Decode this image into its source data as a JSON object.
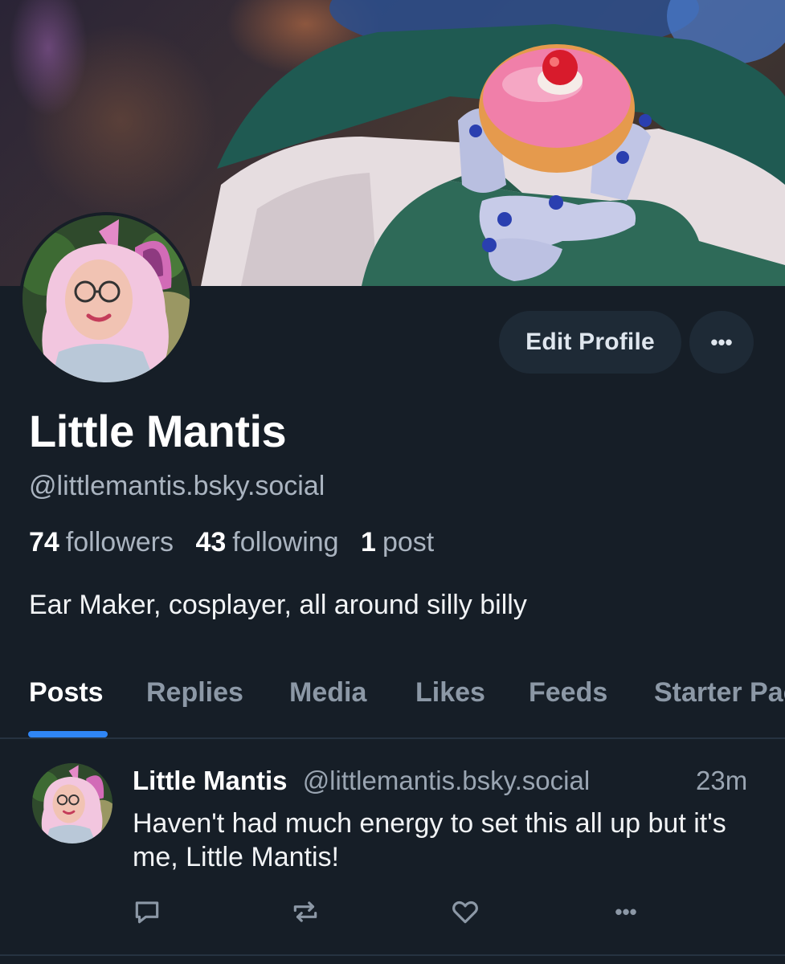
{
  "profile": {
    "display_name": "Little Mantis",
    "handle": "@littlemantis.bsky.social",
    "bio": "Ear Maker, cosplayer, all around silly billy",
    "stats": {
      "followers_count": "74",
      "followers_label": "followers",
      "following_count": "43",
      "following_label": "following",
      "posts_count": "1",
      "posts_label": "post"
    }
  },
  "actions": {
    "edit_profile_label": "Edit Profile",
    "more_label": "•••"
  },
  "tabs": [
    {
      "label": "Posts",
      "active": true
    },
    {
      "label": "Replies",
      "active": false
    },
    {
      "label": "Media",
      "active": false
    },
    {
      "label": "Likes",
      "active": false
    },
    {
      "label": "Feeds",
      "active": false
    },
    {
      "label": "Starter Packs",
      "active": false
    }
  ],
  "post": {
    "author": "Little Mantis",
    "handle": "@littlemantis.bsky.social",
    "time": "23m",
    "text": "Haven't had much energy to set this all up but it's me, Little Mantis!",
    "actions": {
      "reply_icon": "reply-icon",
      "repost_icon": "repost-icon",
      "like_icon": "heart-icon",
      "more_icon": "more-icon",
      "more_label": "•••"
    }
  },
  "colors": {
    "background": "#161e27",
    "accent": "#2f86f6",
    "muted_text": "#aab4c0",
    "button_bg": "#1e2a36"
  }
}
